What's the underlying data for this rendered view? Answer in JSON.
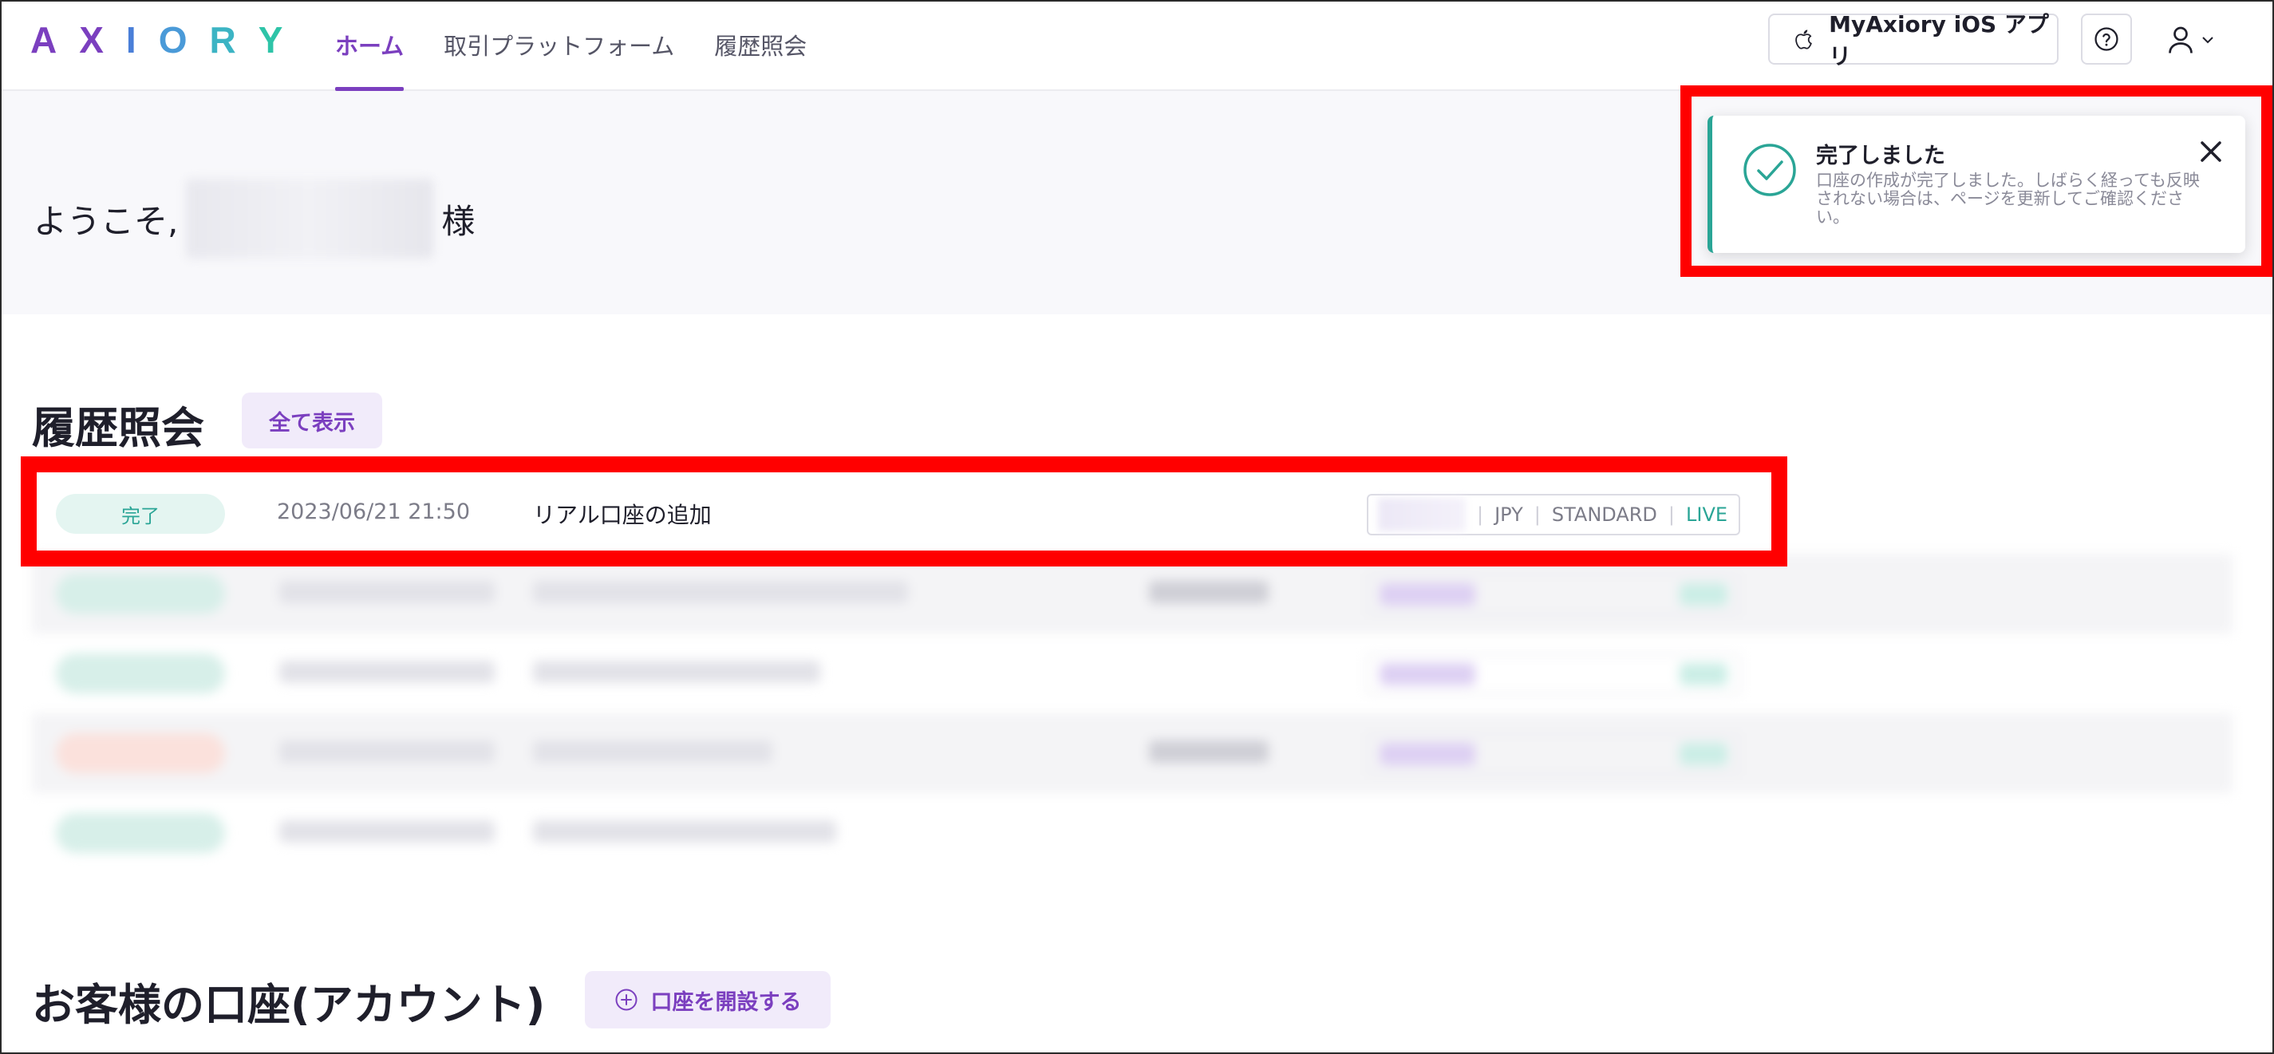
{
  "header": {
    "logo_letters": [
      {
        "char": "A",
        "color": "#7b3fbf"
      },
      {
        "char": "X",
        "color": "#7b3fbf"
      },
      {
        "char": "I",
        "color": "#4a7fd8"
      },
      {
        "char": "O",
        "color": "#4a9ad8"
      },
      {
        "char": "R",
        "color": "#3cb4c4"
      },
      {
        "char": "Y",
        "color": "#2ec4a8"
      }
    ],
    "nav": {
      "home": "ホーム",
      "platform": "取引プラットフォーム",
      "history": "履歴照会"
    },
    "ios_button": "MyAxiory iOS アプリ",
    "help_icon": "question-circle-icon",
    "user_icon": "user-icon"
  },
  "welcome": {
    "prefix": "ようこそ,",
    "suffix": "様"
  },
  "toast": {
    "title": "完了しました",
    "body": "口座の作成が完了しました。しばらく経っても反映されない場合は、ページを更新してご確認ください。",
    "icon": "check-circle-icon",
    "close_icon": "close-icon",
    "accent": "#2aa596"
  },
  "history": {
    "title": "履歴照会",
    "show_all": "全て表示",
    "rows": [
      {
        "status": "完了",
        "datetime": "2023/06/21 21:50",
        "description": "リアル口座の追加",
        "currency": "JPY",
        "type": "STANDARD",
        "mode": "LIVE"
      }
    ]
  },
  "accounts": {
    "title": "お客様の口座(アカウント)",
    "open_button": "口座を開設する"
  },
  "colors": {
    "brand_purple": "#7b3fbf",
    "teal": "#2aa596",
    "highlight_red": "#ff0000"
  }
}
